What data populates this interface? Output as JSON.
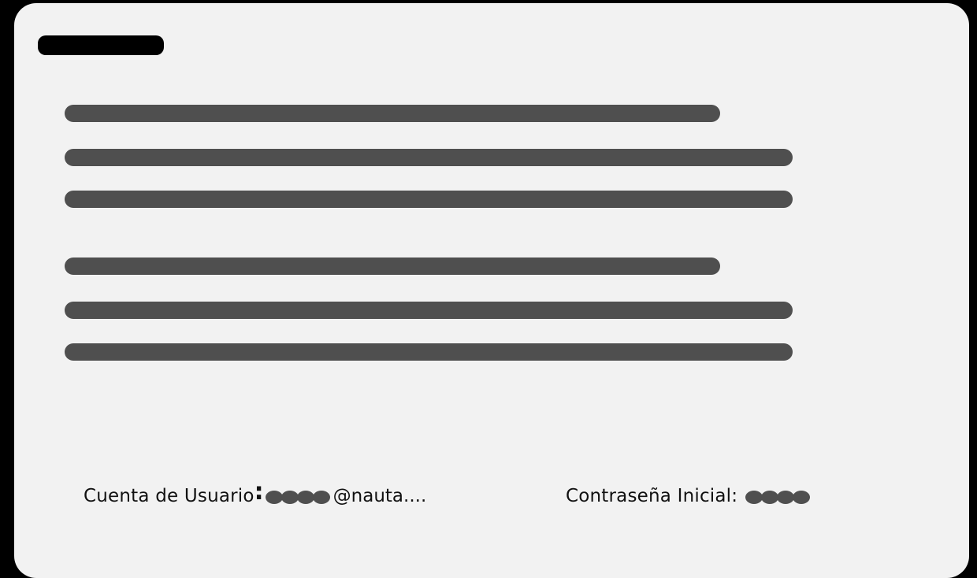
{
  "document": {
    "title_redacted": true,
    "paragraphs": [
      {
        "lines_redacted": 3
      },
      {
        "lines_redacted": 3
      }
    ]
  },
  "fields": {
    "user_account": {
      "label": "Cuenta de Usuario",
      "colon": ":",
      "masked_chars": 4,
      "suffix": "@nauta...."
    },
    "initial_password": {
      "label": "Contraseña Inicial",
      "colon": ":",
      "masked_chars": 4
    }
  },
  "colors": {
    "background": "#000000",
    "card": "#f2f2f2",
    "redaction_bar": "#4f4f4f",
    "title_bar": "#000000",
    "text": "#111111"
  }
}
